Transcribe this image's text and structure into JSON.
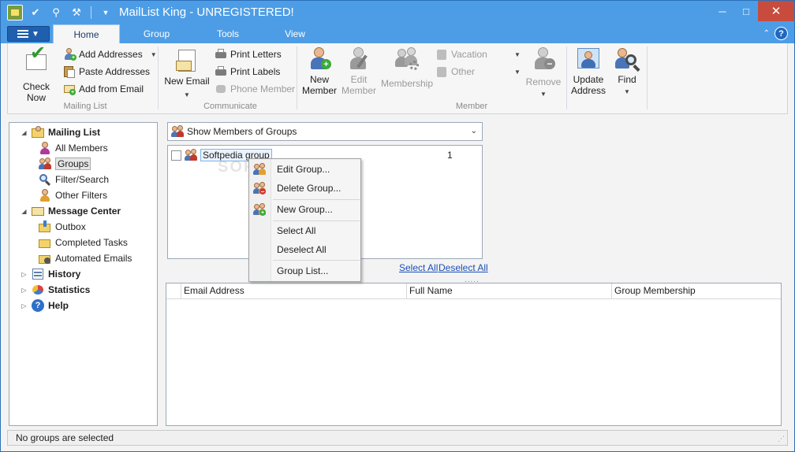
{
  "window": {
    "title": "MailList King - UNREGISTERED!",
    "accent": "#4d9de6"
  },
  "tabs": [
    {
      "label": "Home",
      "active": true
    },
    {
      "label": "Group"
    },
    {
      "label": "Tools"
    },
    {
      "label": "View"
    }
  ],
  "ribbon": {
    "mailing_list": {
      "label": "Mailing List",
      "check_now": "Check Now",
      "add_addresses": "Add Addresses",
      "paste_addresses": "Paste Addresses",
      "add_from_email": "Add from Email"
    },
    "communicate": {
      "label": "Communicate",
      "new_email_line1": "New Email",
      "print_letters": "Print Letters",
      "print_labels": "Print Labels",
      "phone_member": "Phone Member"
    },
    "member": {
      "label": "Member",
      "new_member_1": "New",
      "new_member_2": "Member",
      "edit_member_1": "Edit",
      "edit_member_2": "Member",
      "membership": "Membership",
      "vacation": "Vacation",
      "other": "Other",
      "remove": "Remove",
      "update_address_1": "Update",
      "update_address_2": "Address",
      "find": "Find"
    }
  },
  "nav": {
    "mailing_list": "Mailing List",
    "all_members": "All Members",
    "groups": "Groups",
    "filter_search": "Filter/Search",
    "other_filters": "Other Filters",
    "message_center": "Message Center",
    "outbox": "Outbox",
    "completed_tasks": "Completed Tasks",
    "automated_emails": "Automated Emails",
    "history": "History",
    "statistics": "Statistics",
    "help": "Help"
  },
  "groups_panel": {
    "combo_value": "Show Members of Groups",
    "groups": [
      {
        "name": "Softpedia group",
        "count": "1"
      }
    ],
    "select_all": "Select All",
    "deselect_all": "Deselect All",
    "watermark": "SOFTPEDIA"
  },
  "members_table": {
    "columns": [
      "Email Address",
      "Full Name",
      "Group Membership"
    ]
  },
  "context_menu": {
    "items": [
      "Edit Group...",
      "Delete Group...",
      "New Group...",
      "Select All",
      "Deselect All",
      "Group List..."
    ]
  },
  "status": {
    "text": "No groups are selected"
  }
}
